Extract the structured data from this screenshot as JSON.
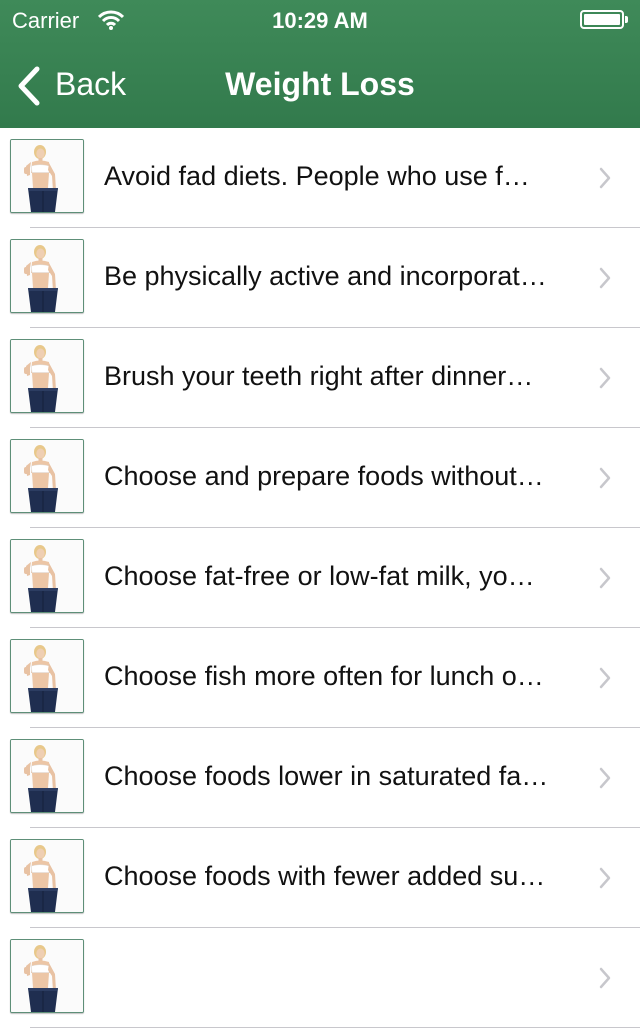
{
  "status_bar": {
    "carrier": "Carrier",
    "time": "10:29 AM",
    "wifi_icon": "wifi-icon",
    "battery_icon": "battery-icon"
  },
  "nav": {
    "back_label": "Back",
    "title": "Weight Loss",
    "back_icon": "chevron-left-icon"
  },
  "colors": {
    "header_green": "#3a8354",
    "separator": "#c8c7cc",
    "chevron": "#c7c7cc"
  },
  "tips": [
    {
      "text": "Avoid fad diets.  People who use f…"
    },
    {
      "text": "Be physically active and incorporat…"
    },
    {
      "text": "Brush your teeth right after dinner…"
    },
    {
      "text": "Choose and prepare foods without…"
    },
    {
      "text": "Choose fat-free or low-fat milk, yo…"
    },
    {
      "text": "Choose fish more often for lunch o…"
    },
    {
      "text": "Choose foods lower in saturated fa…"
    },
    {
      "text": "Choose foods with fewer added su…"
    },
    {
      "text": ""
    }
  ]
}
